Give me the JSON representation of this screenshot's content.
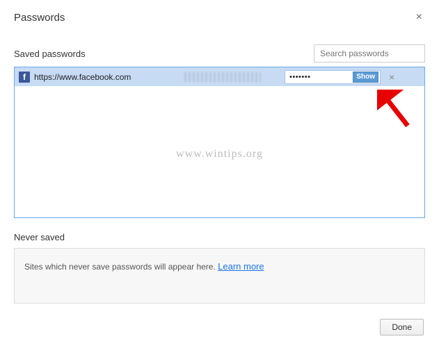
{
  "title": "Passwords",
  "close_glyph": "×",
  "saved": {
    "label": "Saved passwords",
    "search_placeholder": "Search passwords",
    "rows": [
      {
        "icon_letter": "f",
        "site": "https://www.facebook.com",
        "password_mask": "•••••••",
        "show_label": "Show",
        "remove_glyph": "×"
      }
    ]
  },
  "watermark": "www.wintips.org",
  "never": {
    "label": "Never saved",
    "text": "Sites which never save passwords will appear here. ",
    "link": "Learn more"
  },
  "footer": {
    "done": "Done"
  }
}
